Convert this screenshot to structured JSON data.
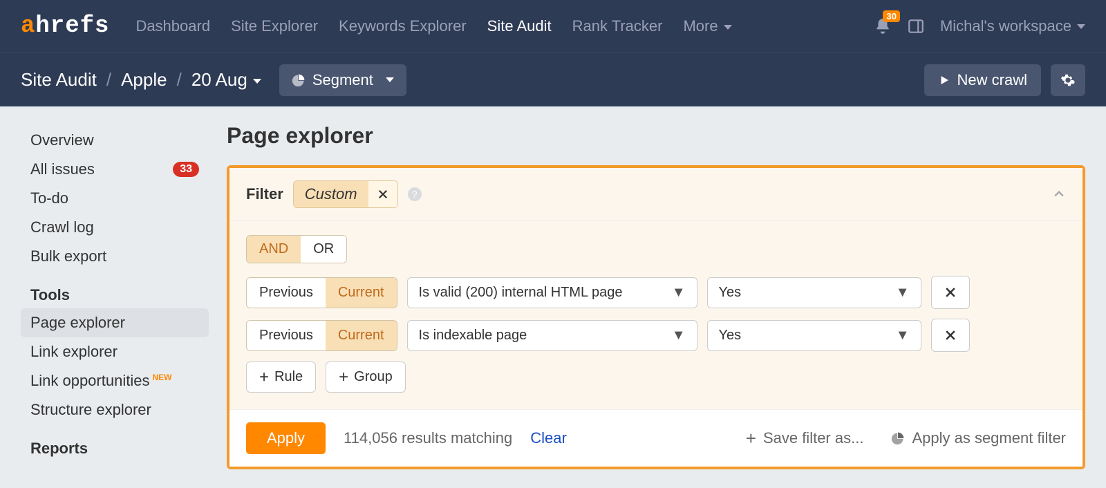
{
  "topnav": {
    "links": [
      "Dashboard",
      "Site Explorer",
      "Keywords Explorer",
      "Site Audit",
      "Rank Tracker",
      "More"
    ],
    "active": "Site Audit",
    "notif_count": "30",
    "workspace": "Michal's workspace"
  },
  "subbar": {
    "crumb1": "Site Audit",
    "crumb2": "Apple",
    "crumb3": "20 Aug",
    "segment_btn": "Segment",
    "new_crawl": "New crawl"
  },
  "sidebar": {
    "items_top": [
      {
        "label": "Overview"
      },
      {
        "label": "All issues",
        "badge": "33"
      },
      {
        "label": "To-do"
      },
      {
        "label": "Crawl log"
      },
      {
        "label": "Bulk export"
      }
    ],
    "section_tools": "Tools",
    "items_tools": [
      {
        "label": "Page explorer",
        "active": true
      },
      {
        "label": "Link explorer"
      },
      {
        "label": "Link opportunities",
        "new": true
      },
      {
        "label": "Structure explorer"
      }
    ],
    "section_reports": "Reports"
  },
  "main": {
    "title": "Page explorer"
  },
  "filter": {
    "label": "Filter",
    "chip": "Custom",
    "logic": {
      "and": "AND",
      "or": "OR",
      "active": "AND"
    },
    "rules": [
      {
        "prev": "Previous",
        "cur": "Current",
        "field": "Is valid (200) internal HTML page",
        "value": "Yes"
      },
      {
        "prev": "Previous",
        "cur": "Current",
        "field": "Is indexable page",
        "value": "Yes"
      }
    ],
    "add_rule": "Rule",
    "add_group": "Group",
    "apply": "Apply",
    "results": "114,056 results matching",
    "clear": "Clear",
    "save_as": "Save filter as...",
    "apply_segment": "Apply as segment filter"
  }
}
